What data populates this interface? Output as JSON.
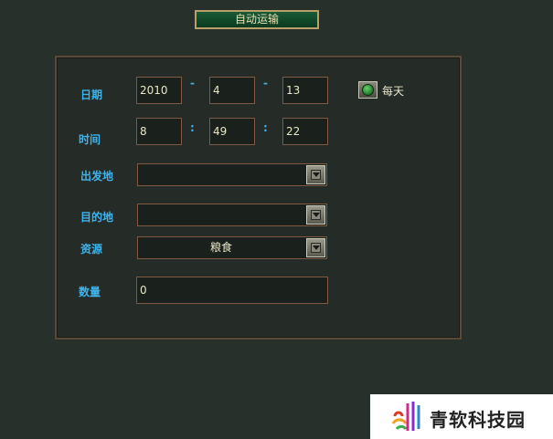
{
  "header": {
    "title": "自动运输"
  },
  "form": {
    "date_label": "日期",
    "date_year": "2010",
    "date_sep1": "-",
    "date_month": "4",
    "date_sep2": "-",
    "date_day": "13",
    "daily_label": "每天",
    "daily_checked": true,
    "time_label": "时间",
    "time_hour": "8",
    "time_sep1": ":",
    "time_minute": "49",
    "time_sep2": ":",
    "time_second": "22",
    "origin_label": "出发地",
    "origin_value": "",
    "destination_label": "目的地",
    "destination_value": "",
    "resource_label": "资源",
    "resource_value": "粮食",
    "quantity_label": "数量",
    "quantity_value": "0"
  },
  "watermark": {
    "text": "青软科技园"
  },
  "colors": {
    "label": "#3fb4ec",
    "value": "#e8e6c8",
    "border": "#7e5a42",
    "background": "#28302b",
    "title_bg": "#1a5a36"
  }
}
